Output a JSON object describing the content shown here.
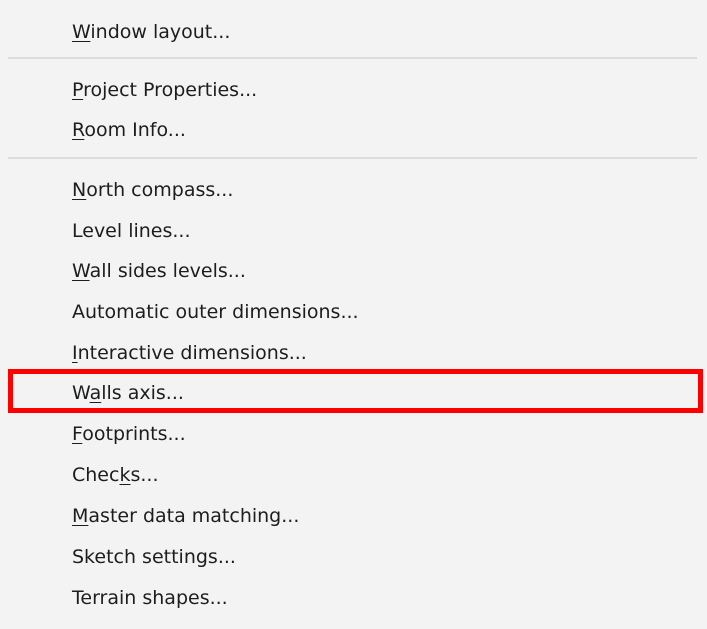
{
  "menu": {
    "items": [
      {
        "pre": "",
        "acc": "W",
        "post": "indow layout..."
      },
      {
        "pre": "",
        "acc": "P",
        "post": "roject Properties..."
      },
      {
        "pre": "",
        "acc": "R",
        "post": "oom Info..."
      },
      {
        "pre": "",
        "acc": "N",
        "post": "orth compass..."
      },
      {
        "pre": "Level lines...",
        "acc": "",
        "post": ""
      },
      {
        "pre": "",
        "acc": "W",
        "post": "all sides levels..."
      },
      {
        "pre": "Automatic outer dimensions...",
        "acc": "",
        "post": ""
      },
      {
        "pre": "",
        "acc": "I",
        "post": "nteractive dimensions..."
      },
      {
        "pre": "W",
        "acc": "a",
        "post": "lls axis..."
      },
      {
        "pre": "",
        "acc": "F",
        "post": "ootprints..."
      },
      {
        "pre": "Chec",
        "acc": "k",
        "post": "s..."
      },
      {
        "pre": "",
        "acc": "M",
        "post": "aster data matching..."
      },
      {
        "pre": "Sketch settings...",
        "acc": "",
        "post": ""
      },
      {
        "pre": "Terrain shapes...",
        "acc": "",
        "post": ""
      }
    ]
  },
  "highlight": {
    "color": "#ff0000",
    "target": "walls-axis"
  }
}
